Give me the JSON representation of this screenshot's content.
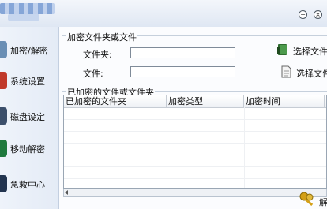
{
  "sidebar": {
    "items": [
      {
        "label": "加密/解密",
        "icon": "lock-icon",
        "color": "#6a8fb5"
      },
      {
        "label": "系统设置",
        "icon": "gear-icon",
        "color": "#c0392b"
      },
      {
        "label": "磁盘设定",
        "icon": "disk-icon",
        "color": "#3b4f6b"
      },
      {
        "label": "移动解密",
        "icon": "usb-icon",
        "color": "#1f7a3e"
      },
      {
        "label": "急救中心",
        "icon": "rescue-icon",
        "color": "#22344f"
      }
    ]
  },
  "form": {
    "group_title": "加密文件夹或文件",
    "folder_label": "文件夹:",
    "folder_value": "",
    "file_label": "文件:",
    "file_value": "",
    "select_folder_label": "选择文件",
    "select_file_label": "选择文件"
  },
  "list": {
    "group_title": "已加密的文件或文件夹",
    "columns": [
      "已加密的文件夹",
      "加密类型",
      "加密时间"
    ]
  },
  "bottom_button": {
    "label": "解"
  }
}
